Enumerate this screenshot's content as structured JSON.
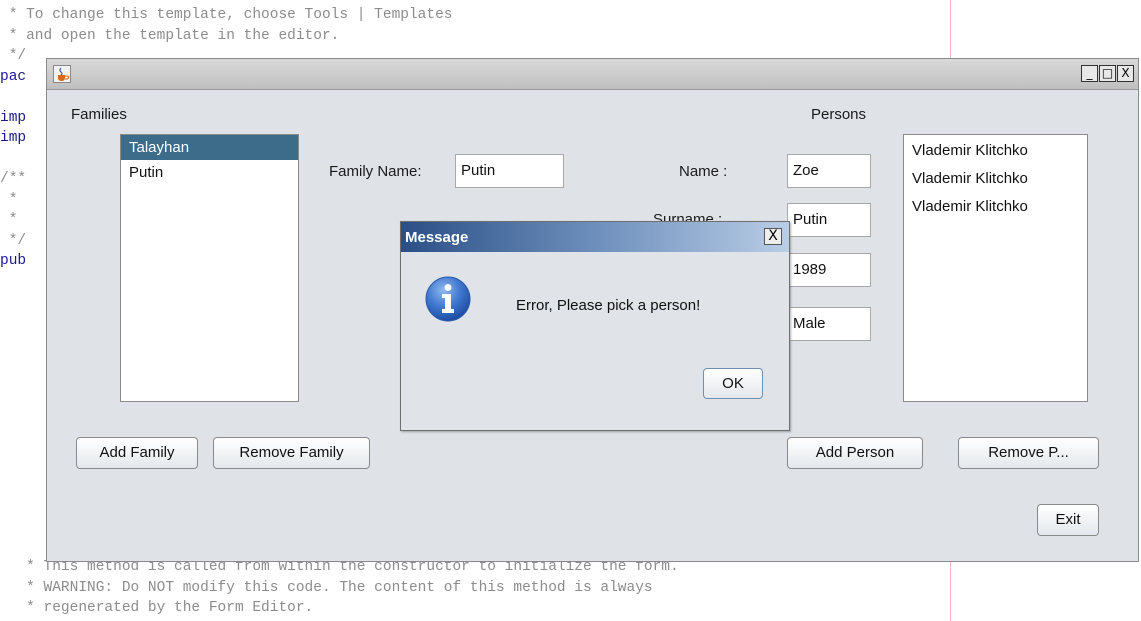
{
  "code_editor": {
    "lines_top": [
      " * To change this template, choose Tools | Templates",
      " * and open the template in the editor.",
      " */",
      "pac",
      "",
      "imp",
      "imp",
      "",
      "/**",
      " *",
      " *",
      " */",
      "pub"
    ],
    "lines_bottom": [
      "   * This method is called from within the constructor to initialize the form.",
      "   * WARNING: Do NOT modify this code. The content of this method is always",
      "   * regenerated by the Form Editor."
    ]
  },
  "window": {
    "title": "",
    "controls": {
      "minimize": "_",
      "maximize": "□",
      "close": "X"
    },
    "families_label": "Families",
    "persons_label": "Persons",
    "families": [
      {
        "name": "Talayhan",
        "selected": true
      },
      {
        "name": "Putin",
        "selected": false
      }
    ],
    "persons": [
      "Vlademir Klitchko",
      "Vlademir Klitchko",
      "Vlademir Klitchko"
    ],
    "family_name_label": "Family Name:",
    "family_name_value": "Putin",
    "name_label": "Name :",
    "name_value": "Zoe",
    "surname_label": "Surname :",
    "surname_value": "Putin",
    "birth_value": "1989",
    "gender_value": "Male",
    "add_family": "Add Family",
    "remove_family": "Remove Family",
    "add_person": "Add Person",
    "remove_person": "Remove P...",
    "exit": "Exit"
  },
  "dialog": {
    "title": "Message",
    "message": "Error, Please pick a person!",
    "ok": "OK",
    "close": "X",
    "icon": "info-icon"
  }
}
